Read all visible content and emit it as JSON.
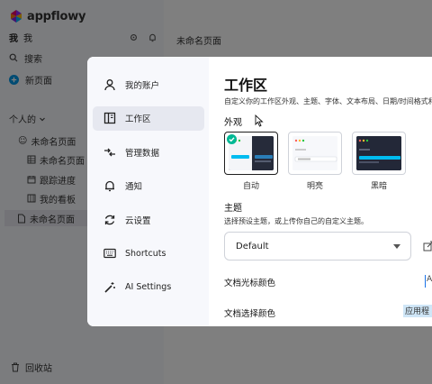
{
  "sidebar": {
    "logo_text": "appflowy",
    "user_avatar": "我",
    "user_name": "我",
    "search": "搜索",
    "new_page": "新页面",
    "section": "个人的",
    "pages": [
      "未命名页面",
      "未命名页面",
      "跟踪进度",
      "我的看板",
      "未命名页面"
    ],
    "trash": "回收站"
  },
  "main": {
    "page_title": "未命名页面"
  },
  "settings": {
    "nav": [
      {
        "label": "我的账户",
        "icon": "user-icon"
      },
      {
        "label": "工作区",
        "icon": "workspace-icon"
      },
      {
        "label": "管理数据",
        "icon": "data-arrows-icon"
      },
      {
        "label": "通知",
        "icon": "bell-icon"
      },
      {
        "label": "云设置",
        "icon": "sync-icon"
      },
      {
        "label": "Shortcuts",
        "icon": "keyboard-icon"
      },
      {
        "label": "AI Settings",
        "icon": "ai-wand-icon"
      }
    ],
    "active_index": 1,
    "workspace": {
      "title": "工作区",
      "description": "自定义你的工作区外观、主题、字体、文本布局、日期/时间格式和",
      "appearance_label": "外观",
      "themes": [
        {
          "label": "自动",
          "selected": true
        },
        {
          "label": "明亮",
          "selected": false
        },
        {
          "label": "黑暗",
          "selected": false
        }
      ],
      "theme_label": "主题",
      "theme_description": "选择预设主题，或上传你自己的自定义主题。",
      "theme_value": "Default",
      "cursor_color_label": "文档光标颜色",
      "cursor_color_value": "A",
      "selection_color_label": "文档选择颜色",
      "selection_color_value": "应用程"
    }
  },
  "colors": {
    "accent_green": "#00b894",
    "cursor_blue": "#1a73e8",
    "selection_blue": "#cfe6f7",
    "app_blue": "#0097e6"
  }
}
